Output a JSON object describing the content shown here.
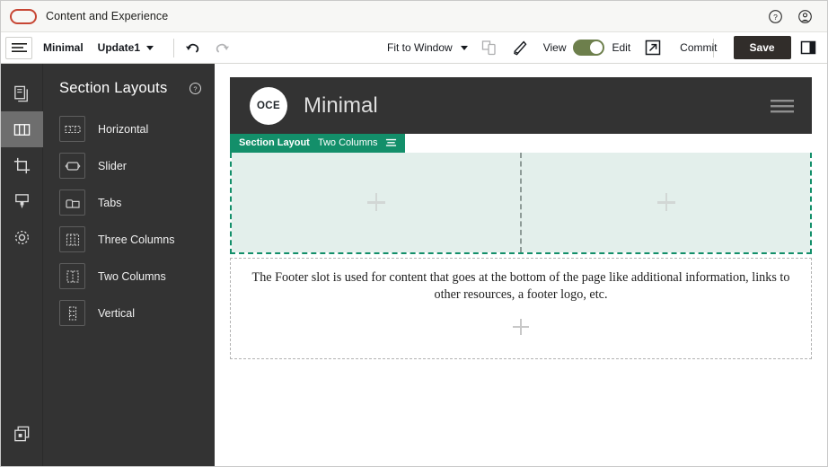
{
  "brandbar": {
    "product_name": "Content and Experience",
    "logo_name": "oracle-logo",
    "help_icon": "help-circle-icon",
    "account_icon": "user-account-icon"
  },
  "toolbar": {
    "menu_icon": "hamburger-menu-icon",
    "site_name": "Minimal",
    "update_name": "Update1",
    "undo_icon": "undo-arrow-icon",
    "redo_icon": "redo-arrow-icon",
    "zoom_label": "Fit to Window",
    "device_preview_icon": "device-preview-icon",
    "style_icon": "paintbrush-style-icon",
    "view_label": "View",
    "edit_label": "Edit",
    "toggle_state": "edit",
    "preview_icon": "open-external-icon",
    "commit_label": "Commit",
    "save_label": "Save",
    "comment_icon": "comment-icon",
    "map_pin_icon": "map-pin-icon",
    "side_panel_icon": "side-panel-icon"
  },
  "rail": {
    "items": [
      {
        "name": "pages-icon",
        "active": false
      },
      {
        "name": "section-layouts-icon",
        "active": true
      },
      {
        "name": "crop-icon",
        "active": false
      },
      {
        "name": "theme-icon",
        "active": false
      },
      {
        "name": "settings-gear-icon",
        "active": false
      }
    ],
    "bottom_item": {
      "name": "components-icon"
    }
  },
  "panel": {
    "title": "Section Layouts",
    "help_icon": "help-circle-icon",
    "items": [
      {
        "label": "Horizontal",
        "icon": "layout-horizontal-icon"
      },
      {
        "label": "Slider",
        "icon": "layout-slider-icon"
      },
      {
        "label": "Tabs",
        "icon": "layout-tabs-icon"
      },
      {
        "label": "Three Columns",
        "icon": "layout-three-columns-icon"
      },
      {
        "label": "Two Columns",
        "icon": "layout-two-columns-icon"
      },
      {
        "label": "Vertical",
        "icon": "layout-vertical-icon"
      }
    ]
  },
  "canvas": {
    "site_header": {
      "logo_text": "OCE",
      "title": "Minimal",
      "menu_icon": "site-hamburger-icon"
    },
    "section_badge": {
      "type_label": "Section Layout",
      "layout_name": "Two Columns",
      "menu_icon": "section-menu-icon"
    },
    "columns": [
      {
        "name": "column-slot-left",
        "add_icon": "plus-icon"
      },
      {
        "name": "column-slot-right",
        "add_icon": "plus-icon"
      }
    ],
    "footer": {
      "text": "The Footer slot is used for content that goes at the bottom of the page like additional information, links to other resources, a footer logo, etc.",
      "add_icon": "plus-icon"
    }
  },
  "colors": {
    "oracle_red": "#c74634",
    "badge_green": "#138f6a",
    "slot_mint": "#e3efeb",
    "toggle_green": "#6d7f4c",
    "save_dark": "#312d2a",
    "panel_dark": "#333333"
  }
}
